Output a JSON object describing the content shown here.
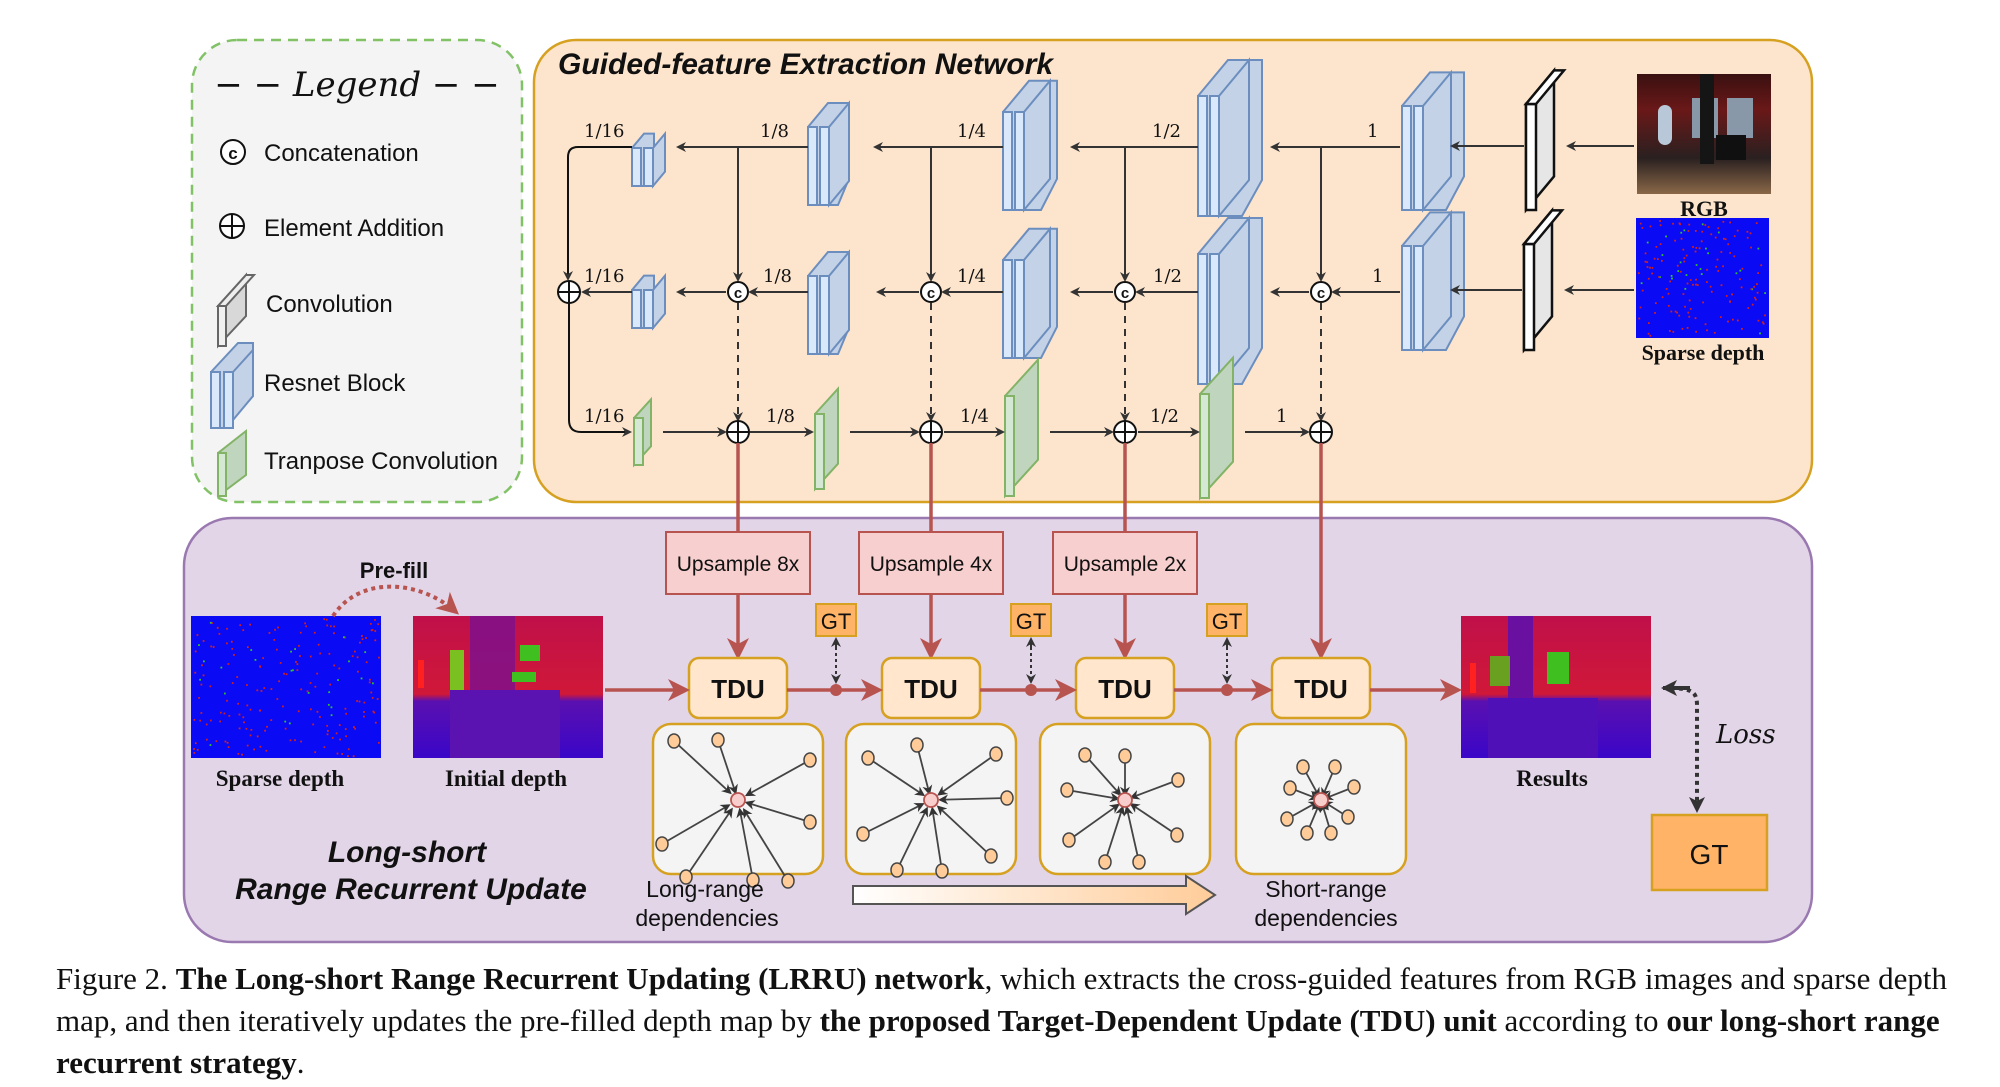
{
  "legend": {
    "title": "− − Legend − −",
    "items": [
      {
        "icon": "concatenation-icon",
        "label": "Concatenation"
      },
      {
        "icon": "element-addition-icon",
        "label": "Element Addition"
      },
      {
        "icon": "convolution-icon",
        "label": "Convolution"
      },
      {
        "icon": "resnet-block-icon",
        "label": "Resnet Block"
      },
      {
        "icon": "transpose-convolution-icon",
        "label": "Tranpose Convolution"
      }
    ]
  },
  "extraction": {
    "title": "Guided-feature  Extraction Network",
    "scales_top": [
      "1/16",
      "1/8",
      "1/4",
      "1/2",
      "1"
    ],
    "scales_mid": [
      "1/16",
      "1/8",
      "1/4",
      "1/2",
      "1"
    ],
    "scales_bot": [
      "1/16",
      "1/8",
      "1/4",
      "1/2",
      "1"
    ],
    "inputs": [
      {
        "label": "RGB"
      },
      {
        "label": "Sparse depth"
      }
    ],
    "concat_symbol": "c"
  },
  "update": {
    "title_line1": "Long-short",
    "title_line2": "Range Recurrent Update",
    "prefill_label": "Pre-fill",
    "sparse_label": "Sparse depth",
    "initial_label": "Initial depth",
    "results_label": "Results",
    "upsample": [
      "Upsample 8x",
      "Upsample 4x",
      "Upsample 2x"
    ],
    "tdu_label": "TDU",
    "gt_small": "GT",
    "gt_big": "GT",
    "loss_label": "Loss",
    "long_range_1": "Long-range",
    "long_range_2": "dependencies",
    "short_range_1": "Short-range",
    "short_range_2": "dependencies"
  },
  "colors": {
    "extraction_bg": "#fde5cd",
    "extraction_border": "#d6a020",
    "update_bg": "#e2d5e8",
    "update_border": "#9a78b0",
    "resnet_fill": "#c3d2e6",
    "resnet_stroke": "#6c8ebf",
    "tconv_fill": "#c0d5bd",
    "tconv_stroke": "#82b366",
    "upsample_fill": "#f7cfcf",
    "upsample_stroke": "#b85450",
    "red_line": "#b85450",
    "tdu_fill": "#ffe6cc",
    "gt_fill": "#ffb366"
  },
  "caption": {
    "prefix": "Figure 2. ",
    "bold1": "The Long-short Range Recurrent Updating (LRRU) network",
    "text1": ", which extracts the cross-guided features from RGB images and sparse depth map, and then iteratively updates the pre-filled depth map by ",
    "bold2": "the proposed Target-Dependent Update (TDU) unit",
    "text2": " according to ",
    "bold3": "our long-short range recurrent strategy",
    "text3": "."
  }
}
